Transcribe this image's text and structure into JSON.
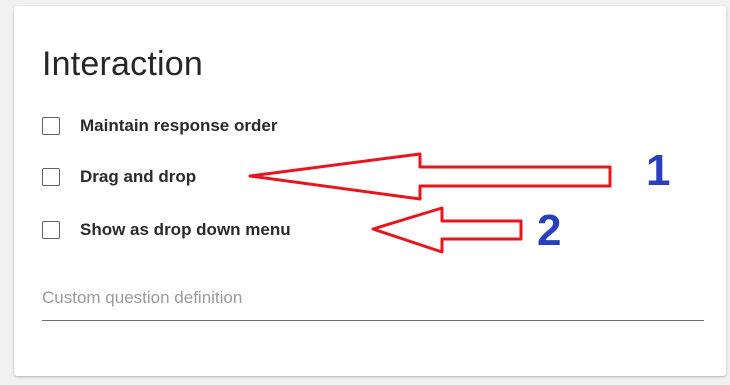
{
  "panel": {
    "title": "Interaction",
    "options": [
      {
        "label": "Maintain response order",
        "checked": false
      },
      {
        "label": "Drag and drop",
        "checked": false
      },
      {
        "label": "Show as drop down menu",
        "checked": false
      }
    ],
    "custom_field": {
      "placeholder": "Custom question definition",
      "value": ""
    }
  },
  "annotations": {
    "arrow_color": "#e8141e",
    "number_color": "#2a3fbf",
    "labels": [
      "1",
      "2"
    ]
  }
}
